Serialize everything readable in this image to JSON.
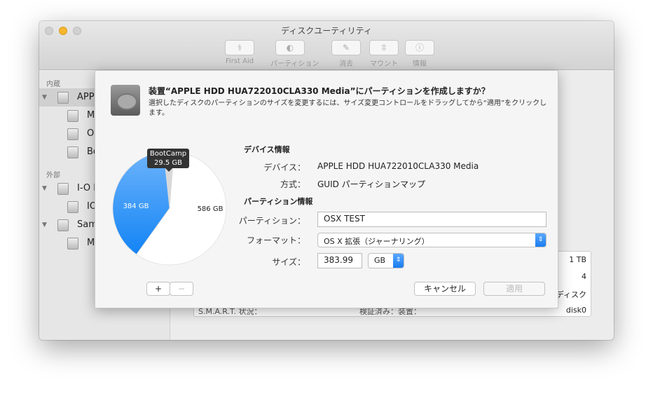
{
  "window": {
    "title": "ディスクユーティリティ"
  },
  "toolbar": [
    {
      "label": "First Aid",
      "icon": "stethoscope-icon",
      "glyph": "⚕"
    },
    {
      "label": "パーティション",
      "icon": "partition-icon",
      "glyph": "◐"
    },
    {
      "label": "消去",
      "icon": "erase-icon",
      "glyph": "✎"
    },
    {
      "label": "マウント",
      "icon": "mount-icon",
      "glyph": "⇳"
    },
    {
      "label": "情報",
      "icon": "info-icon",
      "glyph": "ⓘ"
    }
  ],
  "sidebar": {
    "internal": "内蔵",
    "external": "外部",
    "items": [
      "APPLE",
      "M",
      "O",
      "Bo",
      "I-O D",
      "IO",
      "Sam",
      "M"
    ]
  },
  "info_table": [
    "1 TB",
    "4",
    "ディスク",
    "disk0"
  ],
  "info_bottom": {
    "smart": "S.M.A.R.T. 状況：",
    "verified": "検証済み：装置："
  },
  "sheet": {
    "title": "装置“APPLE HDD HUA722010CLA330 Media”にパーティションを作成しますか？",
    "desc": "選択したディスクのパーティションのサイズを変更するには、サイズ変更コントロールをドラッグしてから“適用”をクリックします。",
    "device_section": "デバイス情報",
    "device_label": "デバイス：",
    "device_value": "APPLE HDD HUA722010CLA330 Media",
    "scheme_label": "方式：",
    "scheme_value": "GUID パーティションマップ",
    "partition_section": "パーティション情報",
    "partition_label": "パーティション：",
    "partition_value": "OSX TEST",
    "format_label": "フォーマット：",
    "format_value": "OS X 拡張（ジャーナリング）",
    "size_label": "サイズ：",
    "size_value": "383.99",
    "size_unit": "GB",
    "add": "+",
    "remove": "−",
    "cancel": "キャンセル",
    "apply": "適用"
  },
  "chart_data": {
    "type": "pie",
    "slices": [
      {
        "label": "BootCamp",
        "value": 29.5,
        "display": "29.5 GB",
        "color": "#d8d8d8"
      },
      {
        "label": "",
        "value": 586,
        "display": "586 GB",
        "color": "#ffffff"
      },
      {
        "label": "",
        "value": 384,
        "display": "384 GB",
        "color": "#2b8ef5"
      }
    ],
    "tooltip": {
      "name": "BootCamp",
      "value": "29.5 GB"
    }
  }
}
